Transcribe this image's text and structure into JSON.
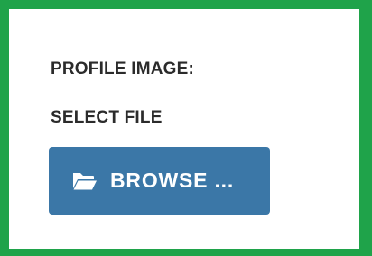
{
  "form": {
    "profile_image_label": "PROFILE IMAGE:",
    "select_file_label": "SELECT FILE",
    "browse_button": {
      "label": "BROWSE ...",
      "icon": "folder-open-icon"
    }
  },
  "colors": {
    "outline": "#1fa34a",
    "button_background": "#3b77a7",
    "button_text": "#ffffff",
    "label_text": "#2b2b2b"
  }
}
